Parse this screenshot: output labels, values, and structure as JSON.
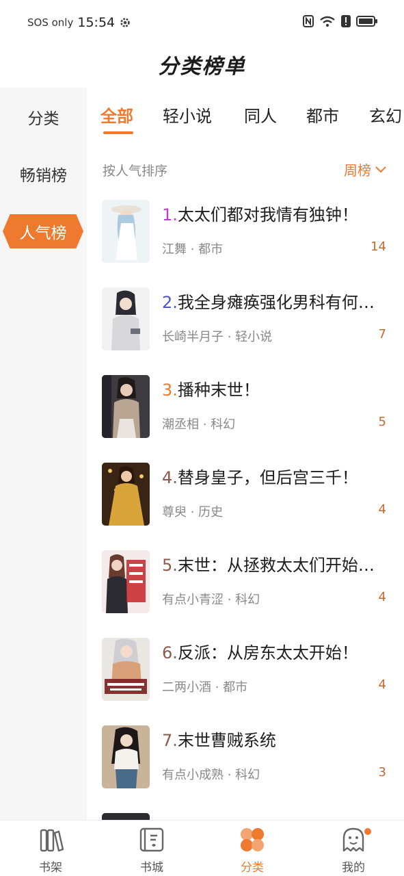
{
  "status_bar": {
    "carrier": "SOS only",
    "time": "15:54"
  },
  "header": {
    "title": "分类榜单"
  },
  "sidebar": {
    "items": [
      {
        "label": "分类"
      },
      {
        "label": "畅销榜"
      },
      {
        "label": "人气榜",
        "active": true
      }
    ]
  },
  "tabs": [
    {
      "label": "全部",
      "active": true
    },
    {
      "label": "轻小说"
    },
    {
      "label": "同人"
    },
    {
      "label": "都市"
    },
    {
      "label": "玄幻"
    }
  ],
  "sort": {
    "label": "按人气排序",
    "period": "周榜"
  },
  "books": [
    {
      "rank": "1.",
      "rank_color": "#c03bd6",
      "title": "太太们都对我情有独钟！",
      "author": "江舞",
      "genre": "都市",
      "count": "14"
    },
    {
      "rank": "2.",
      "rank_color": "#4f55c9",
      "title": "我全身瘫痪强化男科有何…",
      "author": "长崎半月子",
      "genre": "轻小说",
      "count": "7"
    },
    {
      "rank": "3.",
      "rank_color": "#ee7a2f",
      "title": "播种末世！",
      "author": "潮丞相",
      "genre": "科幻",
      "count": "5"
    },
    {
      "rank": "4.",
      "rank_color": "#8a5a4a",
      "title": "替身皇子，但后宫三千！",
      "author": "尊臾",
      "genre": "历史",
      "count": "4"
    },
    {
      "rank": "5.",
      "rank_color": "#8a5a4a",
      "title": "末世：从拯救太太们开始…",
      "author": "有点小青涩",
      "genre": "科幻",
      "count": "4"
    },
    {
      "rank": "6.",
      "rank_color": "#8a5a4a",
      "title": "反派：从房东太太开始！",
      "author": "二两小酒",
      "genre": "都市",
      "count": "4"
    },
    {
      "rank": "7.",
      "rank_color": "#8a5a4a",
      "title": "末世曹贼系统",
      "author": "有点小成熟",
      "genre": "科幻",
      "count": "3"
    }
  ],
  "bottom_nav": [
    {
      "label": "书架",
      "icon": "bookshelf-icon"
    },
    {
      "label": "书城",
      "icon": "bookstore-icon"
    },
    {
      "label": "分类",
      "icon": "category-icon",
      "active": true
    },
    {
      "label": "我的",
      "icon": "profile-ghost-icon"
    }
  ],
  "colors": {
    "accent": "#ee7a2f",
    "sidebar_bg": "#f6f6f6"
  }
}
